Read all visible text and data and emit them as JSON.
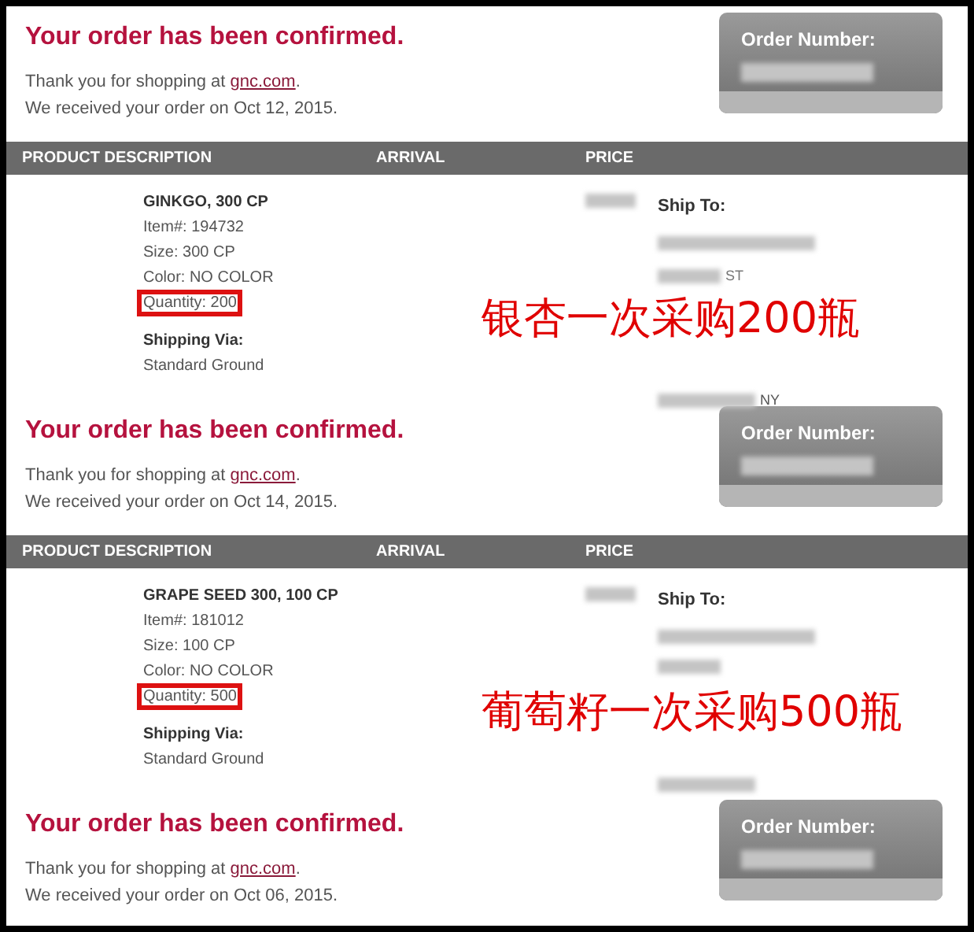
{
  "orders": [
    {
      "title": "Your order has been confirmed.",
      "thanks": "Thank you for shopping at",
      "link": "gnc.com",
      "after_link": ".",
      "received": "We received your order on Oct 12, 2015.",
      "order_number_label": "Order Number:",
      "columns": [
        "PRODUCT DESCRIPTION",
        "ARRIVAL",
        "PRICE"
      ],
      "item": {
        "name": "GINKGO, 300 CP",
        "lines": [
          "Item#: 194732",
          "Size: 300 CP",
          "Color: NO COLOR"
        ],
        "quantity": {
          "text": "Quantity: 200",
          "highlighted": true
        },
        "shipping_via_label": "Shipping Via:",
        "shipping_via": "Standard Ground",
        "ship_to_label": "Ship To:",
        "address_fragments": [
          "ST",
          "NY"
        ],
        "annotation": "银杏一次采购200瓶"
      }
    },
    {
      "title": "Your order has been confirmed.",
      "thanks": "Thank you for shopping at",
      "link": "gnc.com",
      "after_link": ".",
      "received": "We received your order on Oct 14, 2015.",
      "order_number_label": "Order Number:",
      "columns": [
        "PRODUCT DESCRIPTION",
        "ARRIVAL",
        "PRICE"
      ],
      "item": {
        "name": "GRAPE SEED 300, 100 CP",
        "lines": [
          "Item#: 181012",
          "Size: 100 CP",
          "Color: NO COLOR"
        ],
        "quantity": {
          "text": "Quantity: 500",
          "highlighted": true
        },
        "shipping_via_label": "Shipping Via:",
        "shipping_via": "Standard Ground",
        "ship_to_label": "Ship To:",
        "annotation": "葡萄籽一次采购500瓶"
      }
    },
    {
      "title": "Your order has been confirmed.",
      "thanks": "Thank you for shopping at",
      "link": "gnc.com",
      "after_link": ".",
      "received": "We received your order on Oct 06, 2015.",
      "order_number_label": "Order Number:"
    }
  ]
}
